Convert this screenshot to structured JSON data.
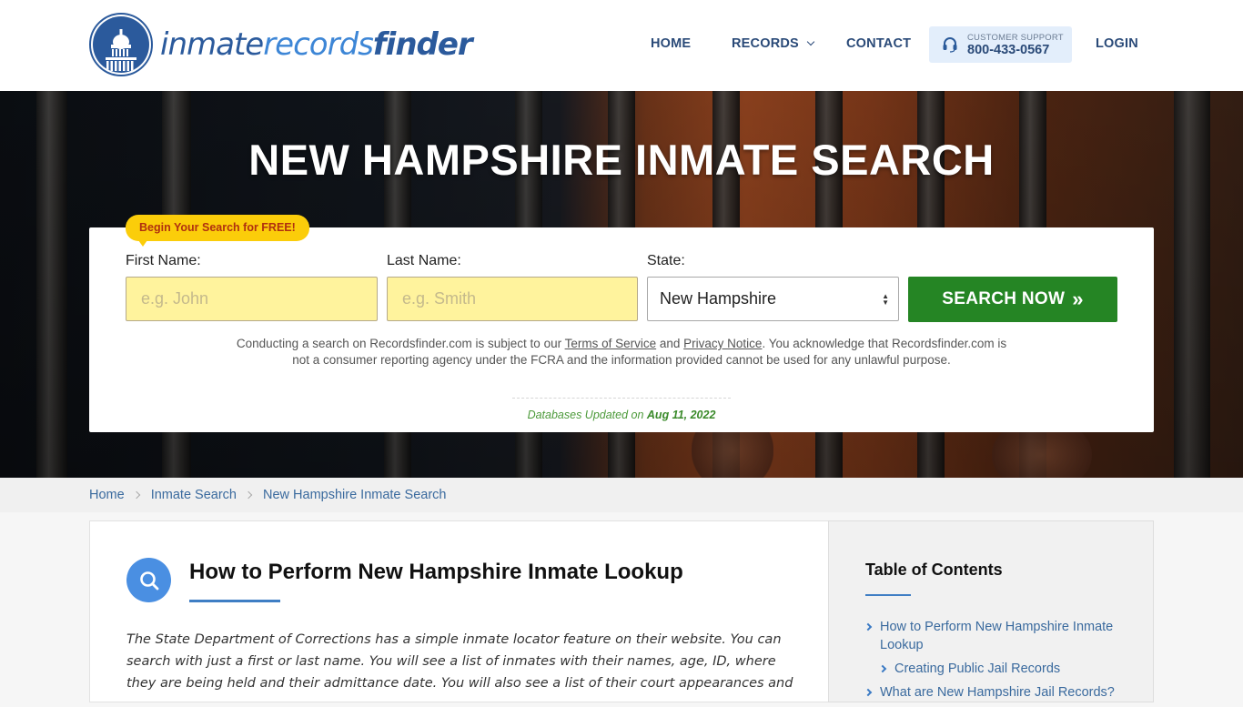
{
  "header": {
    "logo": {
      "part1": "inmate",
      "part2": "records",
      "part3": "finder"
    },
    "nav": {
      "home": "HOME",
      "records": "RECORDS",
      "contact": "CONTACT",
      "login": "LOGIN"
    },
    "support": {
      "label": "CUSTOMER SUPPORT",
      "phone": "800-433-0567",
      "icon": "headset-icon"
    }
  },
  "hero": {
    "title": "NEW HAMPSHIRE INMATE SEARCH",
    "badge": "Begin Your Search for FREE!",
    "first_name": {
      "label": "First Name:",
      "placeholder": "e.g. John",
      "value": ""
    },
    "last_name": {
      "label": "Last Name:",
      "placeholder": "e.g. Smith",
      "value": ""
    },
    "state": {
      "label": "State:",
      "selected": "New Hampshire"
    },
    "search_button": "SEARCH NOW",
    "disclaimer": {
      "pre": "Conducting a search on Recordsfinder.com is subject to our ",
      "terms": "Terms of Service",
      "and": " and ",
      "privacy": "Privacy Notice",
      "post": ". You acknowledge that Recordsfinder.com is not a consumer reporting agency under the FCRA and the information provided cannot be used for any unlawful purpose."
    },
    "updated_label": "Databases Updated on ",
    "updated_date": "Aug 11, 2022"
  },
  "breadcrumb": [
    "Home",
    "Inmate Search",
    "New Hampshire Inmate Search"
  ],
  "article": {
    "title": "How to Perform New Hampshire Inmate Lookup",
    "body": "The State Department of Corrections has a simple inmate locator feature on their website. You can search with just a first or last name. You will see a list of inmates with their names, age, ID, where they are being held and their admittance date. You will also see a list of their court appearances and"
  },
  "toc": {
    "title": "Table of Contents",
    "items": [
      {
        "label": "How to Perform New Hampshire Inmate Lookup",
        "level": 1
      },
      {
        "label": "Creating Public Jail Records",
        "level": 2
      },
      {
        "label": "What are New Hampshire Jail Records?",
        "level": 1
      }
    ]
  }
}
